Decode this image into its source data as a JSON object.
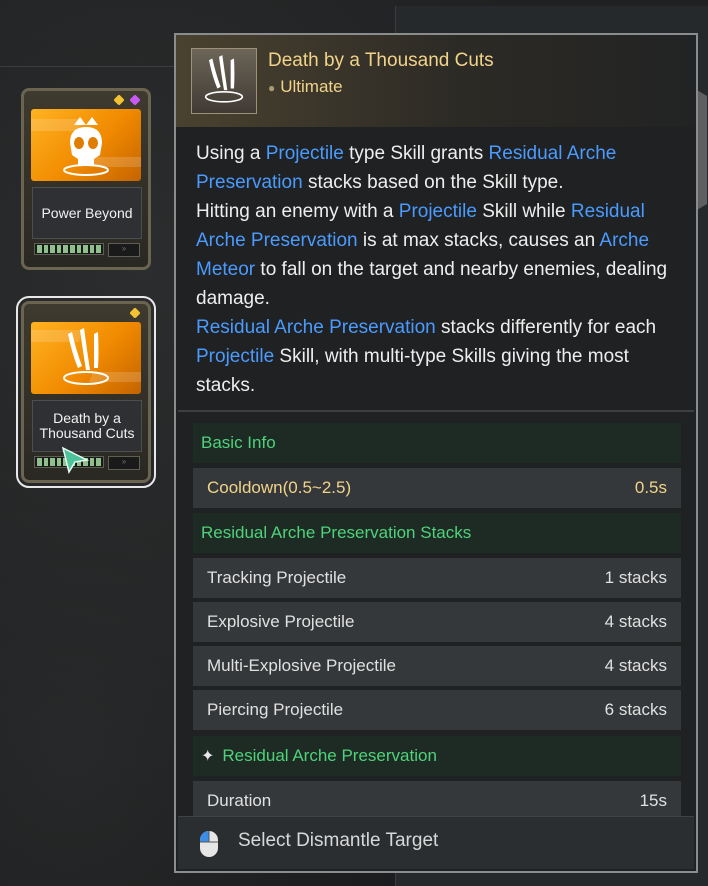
{
  "cards": [
    {
      "label": "Power Beyond",
      "gem_colors": [
        "#f2c233",
        "#c85af2"
      ]
    },
    {
      "label": "Death by a Thousand Cuts",
      "gem_colors": [
        "#f2c233"
      ]
    }
  ],
  "tooltip": {
    "title": "Death by a Thousand Cuts",
    "subtitle": "Ultimate",
    "description": {
      "p1_a": "Using a ",
      "p1_kw1": "Projectile",
      "p1_b": " type Skill grants ",
      "p1_kw2": "Residual Arche Preservation",
      "p1_c": " stacks based on the Skill type.",
      "p2_a": "Hitting an enemy with a ",
      "p2_kw1": "Projectile",
      "p2_b": " Skill while ",
      "p2_kw2": "Residual Arche Preservation",
      "p2_c": " is at max stacks, causes an ",
      "p2_kw3": "Arche Meteor",
      "p2_d": " to fall on the target and nearby enemies, dealing damage.",
      "p3_kw1": "Residual Arche Preservation",
      "p3_a": " stacks differently for each ",
      "p3_kw2": "Projectile",
      "p3_b": " Skill, with multi-type Skills giving the most stacks."
    },
    "basic_info_header": "Basic Info",
    "cooldown": {
      "label": "Cooldown(0.5~2.5)",
      "value": "0.5s"
    },
    "stacks_header": "Residual Arche Preservation Stacks",
    "stacks": [
      {
        "label": "Tracking Projectile",
        "value": "1 stacks"
      },
      {
        "label": "Explosive Projectile",
        "value": "4 stacks"
      },
      {
        "label": "Multi-Explosive Projectile",
        "value": "4 stacks"
      },
      {
        "label": "Piercing Projectile",
        "value": "6 stacks"
      }
    ],
    "preservation_header": "Residual Arche Preservation",
    "duration": {
      "label": "Duration",
      "value": "15s"
    },
    "footer": "Select Dismantle Target"
  },
  "colors": {
    "keyword": "#4b9bff",
    "title": "#f1d38a",
    "section": "#4fd27a"
  },
  "icons": [
    "claw-slash-icon",
    "skull-crown-icon",
    "star-icon",
    "mouse-icon",
    "cursor-arrow-icon"
  ]
}
